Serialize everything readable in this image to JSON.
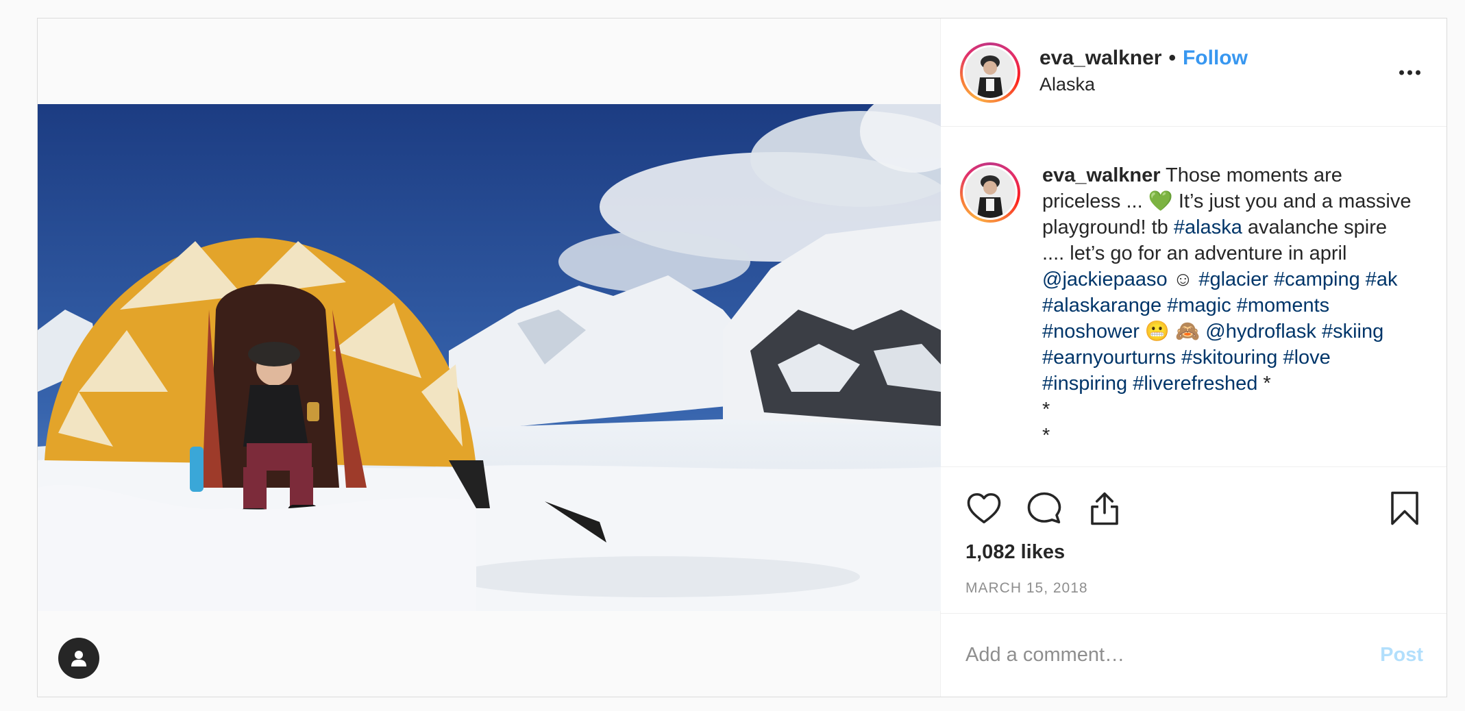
{
  "post": {
    "username": "eva_walkner",
    "separator": "•",
    "follow_label": "Follow",
    "location": "Alaska",
    "caption": {
      "username": "eva_walkner",
      "segments": [
        {
          "text": " Those moments are priceless ... 💚  It’s just you and a massive playground! tb ",
          "link": false
        },
        {
          "text": "#alaska",
          "link": true
        },
        {
          "text": " avalanche spire .... let’s go for an adventure in april ",
          "link": false
        },
        {
          "text": "@jackiepaaso",
          "link": true
        },
        {
          "text": " ☺ ",
          "link": false
        },
        {
          "text": "#glacier",
          "link": true
        },
        {
          "text": " ",
          "link": false
        },
        {
          "text": "#camping",
          "link": true
        },
        {
          "text": " ",
          "link": false
        },
        {
          "text": "#ak",
          "link": true
        },
        {
          "text": " ",
          "link": false
        },
        {
          "text": "#alaskarange",
          "link": true
        },
        {
          "text": " ",
          "link": false
        },
        {
          "text": "#magic",
          "link": true
        },
        {
          "text": " ",
          "link": false
        },
        {
          "text": "#moments",
          "link": true
        },
        {
          "text": " ",
          "link": false
        },
        {
          "text": "#noshower",
          "link": true
        },
        {
          "text": " 😬 🙈 ",
          "link": false
        },
        {
          "text": "@hydroflask",
          "link": true
        },
        {
          "text": " ",
          "link": false
        },
        {
          "text": "#skiing",
          "link": true
        },
        {
          "text": " ",
          "link": false
        },
        {
          "text": "#earnyourturns",
          "link": true
        },
        {
          "text": " ",
          "link": false
        },
        {
          "text": "#skitouring",
          "link": true
        },
        {
          "text": " ",
          "link": false
        },
        {
          "text": "#love",
          "link": true
        },
        {
          "text": " ",
          "link": false
        },
        {
          "text": "#inspiring",
          "link": true
        },
        {
          "text": " ",
          "link": false
        },
        {
          "text": "#liverefreshed",
          "link": true
        },
        {
          "text": " *",
          "link": false
        }
      ],
      "trailing_lines": [
        "*",
        "*"
      ]
    },
    "likes": "1,082 likes",
    "date": "MARCH 15, 2018",
    "comment_placeholder": "Add a comment…",
    "post_label": "Post"
  },
  "icons": {
    "tag": "user-tag-icon",
    "more": "more-options-icon",
    "like": "heart-icon",
    "comment": "comment-icon",
    "share": "share-icon",
    "save": "bookmark-icon"
  },
  "colors": {
    "link": "#003569",
    "follow": "#3897f0",
    "post_disabled": "#b2dffc",
    "muted": "#8e8e8e"
  }
}
